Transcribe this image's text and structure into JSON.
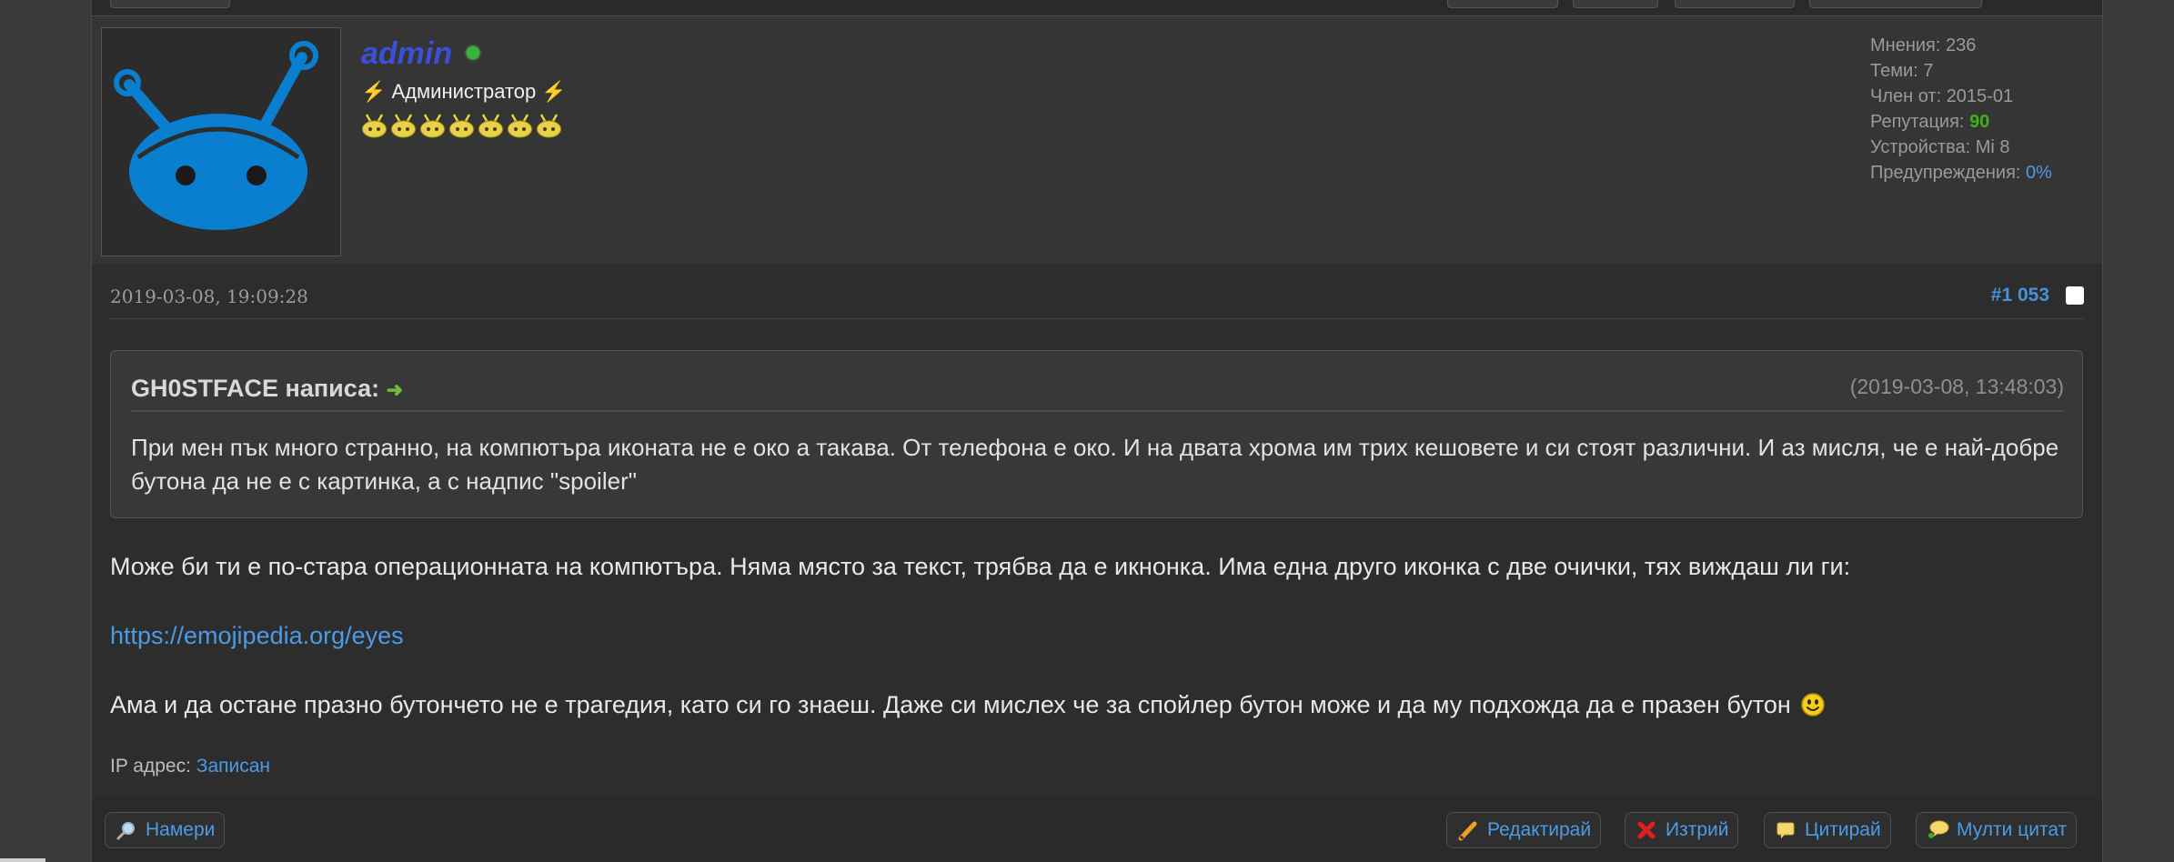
{
  "author": {
    "username": "admin",
    "role": "Администратор",
    "role_prefix": "⚡",
    "role_suffix": "⚡",
    "stars_count": 7,
    "stats": {
      "opinions_label": "Мнения:",
      "opinions_value": "236",
      "topics_label": "Теми:",
      "topics_value": "7",
      "member_label": "Член от:",
      "member_value": "2015-01",
      "reputation_label": "Репутация:",
      "reputation_value": "90",
      "devices_label": "Устройства:",
      "devices_value": "Mi 8",
      "warnings_label": "Предупреждения:",
      "warnings_value": "0%"
    }
  },
  "post": {
    "date": "2019-03-08, 19:09:28",
    "number": "#1 053",
    "quote": {
      "author_line": "GH0STFACE написа:",
      "arrow": "➜",
      "time": "(2019-03-08, 13:48:03)",
      "text": "При мен пък много странно, на компютъра иконата не е око а такава. От телефона е око. И на двата хрома им трих кешовете и си стоят различни. И аз мисля, че е най-добре бутона да не е с картинка, а с надпис \"spoiler\""
    },
    "paragraph1": "Може би ти е по-стара операционната на компютъра. Няма място за текст, трябва да е икнонка. Има една друго иконка с две очички, тях виждаш ли ги:",
    "link": "https://emojipedia.org/eyes",
    "paragraph2": "Ама и да остане празно бутончето не е трагедия, като си го знаеш. Даже си мислех че за спойлер бутон може и да му подхожда да е празен бутон",
    "ip_label": "IP адрес:",
    "ip_value": "Записан"
  },
  "toolbar": {
    "find": "Намери",
    "edit": "Редактирай",
    "delete": "Изтрий",
    "quote": "Цитирай",
    "multi_quote": "Мулти цитат"
  },
  "colors": {
    "username": "#3b4fd9",
    "link": "#4b9be6",
    "reputation": "#3fb018",
    "online": "#38b43a"
  },
  "icons": [
    "robot-avatar",
    "online-dot",
    "star-icon",
    "arrow-icon",
    "smiley-icon",
    "magnifier-icon",
    "pencil-icon",
    "x-icon",
    "quote-icon",
    "multi-quote-icon"
  ]
}
